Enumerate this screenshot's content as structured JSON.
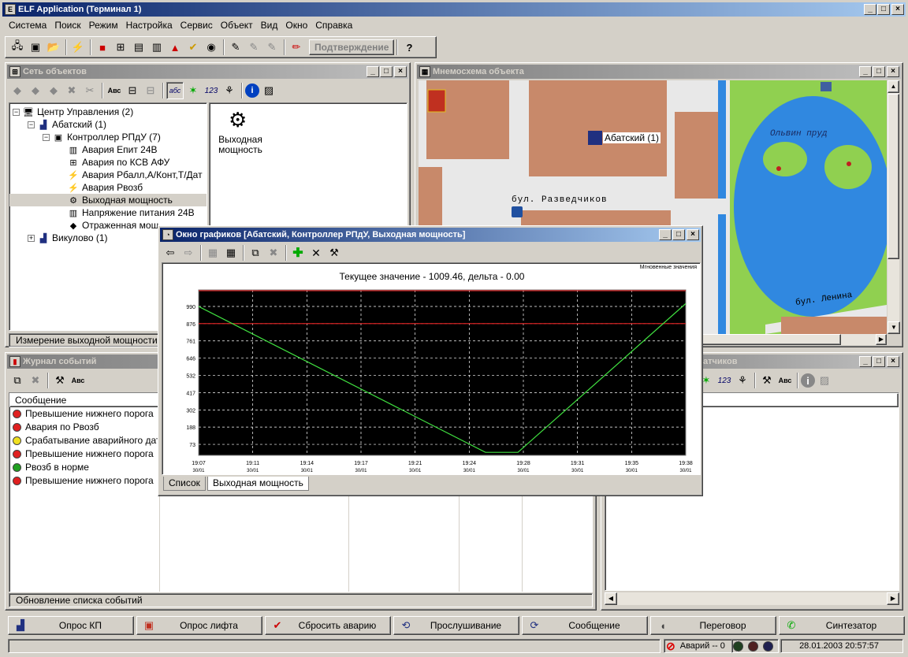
{
  "app": {
    "title": "ELF Application (Терминал 1)"
  },
  "menu": [
    "Система",
    "Поиск",
    "Режим",
    "Настройка",
    "Сервис",
    "Объект",
    "Вид",
    "Окно",
    "Справка"
  ],
  "toolbar": {
    "confirm_label": "Подтверждение",
    "help_label": "?"
  },
  "objects_panel": {
    "title": "Сеть объектов",
    "tree": [
      {
        "label": "Центр Управления (2)",
        "level": 0
      },
      {
        "label": "Абатский (1)",
        "level": 1
      },
      {
        "label": "Контроллер РПдУ (7)",
        "level": 2
      },
      {
        "label": "Авария Епит 24В",
        "level": 3
      },
      {
        "label": "Авария по КСВ АФУ",
        "level": 3
      },
      {
        "label": "Авария Рбалл,А/Конт,Т/Дат",
        "level": 3
      },
      {
        "label": "Авария Рвозб",
        "level": 3
      },
      {
        "label": "Выходная мощность",
        "level": 3
      },
      {
        "label": "Напряжение питания 24В",
        "level": 3
      },
      {
        "label": "Отраженная мощ",
        "level": 3
      },
      {
        "label": "Викулово (1)",
        "level": 1
      }
    ],
    "detail_label": "Выходная мощность",
    "status": "Измерение выходной мощности"
  },
  "map_panel": {
    "title": "Мнемосхема объекта",
    "object_label": "Абатский (1)",
    "street1": "бул. Разведчиков",
    "street2": "бул. Ленина",
    "pond": "Ольвин пруд"
  },
  "events_panel": {
    "title": "Журнал событий",
    "column": "Сообщение",
    "rows": [
      {
        "text": "Превышение нижнего порога",
        "color": "#e02020"
      },
      {
        "text": "Авария по Рвозб",
        "color": "#e02020"
      },
      {
        "text": "Срабатывание аварийного дат...",
        "color": "#f0e020"
      },
      {
        "text": "Превышение нижнего порога",
        "color": "#e02020"
      },
      {
        "text": "Рвозб в норме",
        "color": "#20a020"
      },
      {
        "text": "Превышение нижнего порога",
        "color": "#e02020"
      }
    ],
    "status": "Обновление списка событий"
  },
  "sensors_panel": {
    "title": "датчиков"
  },
  "graph_window": {
    "title": "Окно графиков [Абатский, Контроллер РПдУ, Выходная мощность]",
    "instant_label": "Мгновенные значения",
    "tabs": [
      "Список",
      "Выходная мощность"
    ]
  },
  "chart_data": {
    "type": "line",
    "title": "Текущее значение - 1009.46, дельта - 0.00",
    "y_ticks": [
      73,
      188,
      302,
      417,
      532,
      646,
      761,
      876,
      990
    ],
    "x_ticks": [
      [
        "19:07",
        "30/01"
      ],
      [
        "19:11",
        "30/01"
      ],
      [
        "19:14",
        "30/01"
      ],
      [
        "19:17",
        "30/01"
      ],
      [
        "19:21",
        "30/01"
      ],
      [
        "19:24",
        "30/01"
      ],
      [
        "19:28",
        "30/01"
      ],
      [
        "19:31",
        "30/01"
      ],
      [
        "19:35",
        "30/01"
      ],
      [
        "19:38",
        "30/01"
      ]
    ],
    "ylim": [
      0,
      1100
    ],
    "xlim": [
      0,
      9
    ],
    "threshold": 876,
    "series": [
      {
        "values": [
          [
            0,
            990
          ],
          [
            5.3,
            20
          ],
          [
            5.9,
            20
          ],
          [
            9,
            1009
          ]
        ]
      }
    ],
    "grid": true
  },
  "taskbar": [
    "Опрос КП",
    "Опрос лифта",
    "Сбросить аварию",
    "Прослушивание",
    "Сообщение",
    "Переговор",
    "Синтезатор"
  ],
  "statusbar": {
    "alarms": "Аварий -- 0",
    "datetime": "28.01.2003 20:57:57"
  }
}
